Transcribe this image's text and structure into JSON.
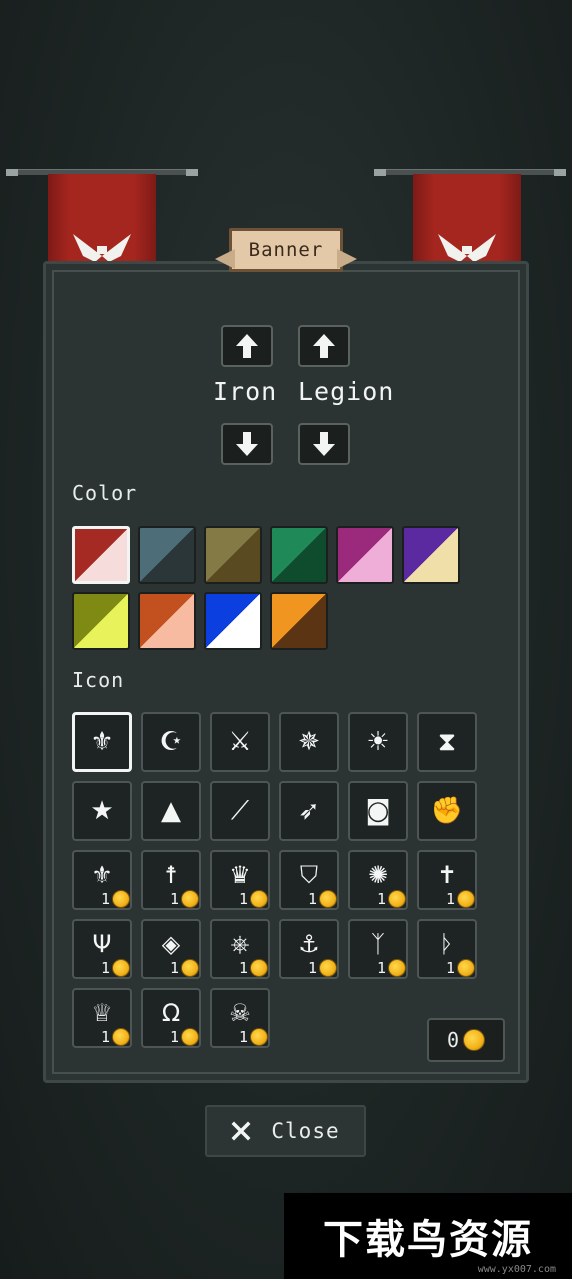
{
  "screen_title": "Banner",
  "banner_name": {
    "first_word": "Iron",
    "second_word": "Legion"
  },
  "arrows": {
    "up_first": "arrow-up-icon",
    "up_second": "arrow-up-icon",
    "down_first": "arrow-down-icon",
    "down_second": "arrow-down-icon"
  },
  "color_section": {
    "label": "Color",
    "swatches": [
      {
        "main": "#a52a24",
        "secondary": "#f7dcdc",
        "selected": true
      },
      {
        "main": "#4d6e78",
        "secondary": "#2a3638"
      },
      {
        "main": "#837a45",
        "secondary": "#5a4a21"
      },
      {
        "main": "#1f8a57",
        "secondary": "#0f4b2d"
      },
      {
        "main": "#9b2a7c",
        "secondary": "#efaed7"
      },
      {
        "main": "#5b2aa0",
        "secondary": "#f0dfa8"
      },
      {
        "main": "#7f8a14",
        "secondary": "#e8f25a"
      },
      {
        "main": "#c3501f",
        "secondary": "#f6bba0"
      },
      {
        "main": "#0b3fe0",
        "secondary": "#ffffff"
      },
      {
        "main": "#f0951f",
        "secondary": "#5a3413"
      }
    ]
  },
  "icon_section": {
    "label": "Icon",
    "free_icons": [
      {
        "name": "winged-crest-icon",
        "glyph": "⚜",
        "selected": true
      },
      {
        "name": "crescent-star-icon",
        "glyph": "☪"
      },
      {
        "name": "crossed-swords-icon",
        "glyph": "⚔"
      },
      {
        "name": "radiant-sword-icon",
        "glyph": "✵"
      },
      {
        "name": "sun-icon",
        "glyph": "☀"
      },
      {
        "name": "hourglass-icon",
        "glyph": "⧗"
      },
      {
        "name": "star-skull-icon",
        "glyph": "★"
      },
      {
        "name": "hooded-figure-icon",
        "glyph": "▲"
      },
      {
        "name": "blade-icon",
        "glyph": "⟋"
      },
      {
        "name": "bow-icon",
        "glyph": "➶"
      },
      {
        "name": "discord-icon",
        "glyph": "◙"
      },
      {
        "name": "fist-icon",
        "glyph": "✊"
      }
    ],
    "premium_icons": [
      {
        "name": "fleur-de-lis-icon",
        "glyph": "⚜",
        "price": "1"
      },
      {
        "name": "figure-cross-icon",
        "glyph": "☨",
        "price": "1"
      },
      {
        "name": "crown-icon",
        "glyph": "♛",
        "price": "1"
      },
      {
        "name": "shield-wing-icon",
        "glyph": "⛉",
        "price": "1"
      },
      {
        "name": "web-icon",
        "glyph": "✺",
        "price": "1"
      },
      {
        "name": "holy-cross-icon",
        "glyph": "✝",
        "price": "1"
      },
      {
        "name": "trident-rune-icon",
        "glyph": "Ψ",
        "price": "1"
      },
      {
        "name": "diamond-eye-icon",
        "glyph": "◈",
        "price": "1"
      },
      {
        "name": "wheel-icon",
        "glyph": "⎈",
        "price": "1"
      },
      {
        "name": "anchor-icon",
        "glyph": "⚓",
        "price": "1"
      },
      {
        "name": "branch-rune-icon",
        "glyph": "ᛉ",
        "price": "1"
      },
      {
        "name": "hook-rune-icon",
        "glyph": "ᚦ",
        "price": "1"
      },
      {
        "name": "claw-crown-icon",
        "glyph": "♕",
        "price": "1"
      },
      {
        "name": "horseshoe-icon",
        "glyph": "Ω",
        "price": "1"
      },
      {
        "name": "skull-compass-icon",
        "glyph": "☠",
        "price": "1"
      }
    ]
  },
  "wallet": {
    "amount": "0",
    "icon": "coin-icon"
  },
  "close_button": {
    "label": "Close",
    "icon": "close-icon"
  },
  "watermark": {
    "text": "下载鸟资源",
    "url_text": "www.yx007.com"
  }
}
